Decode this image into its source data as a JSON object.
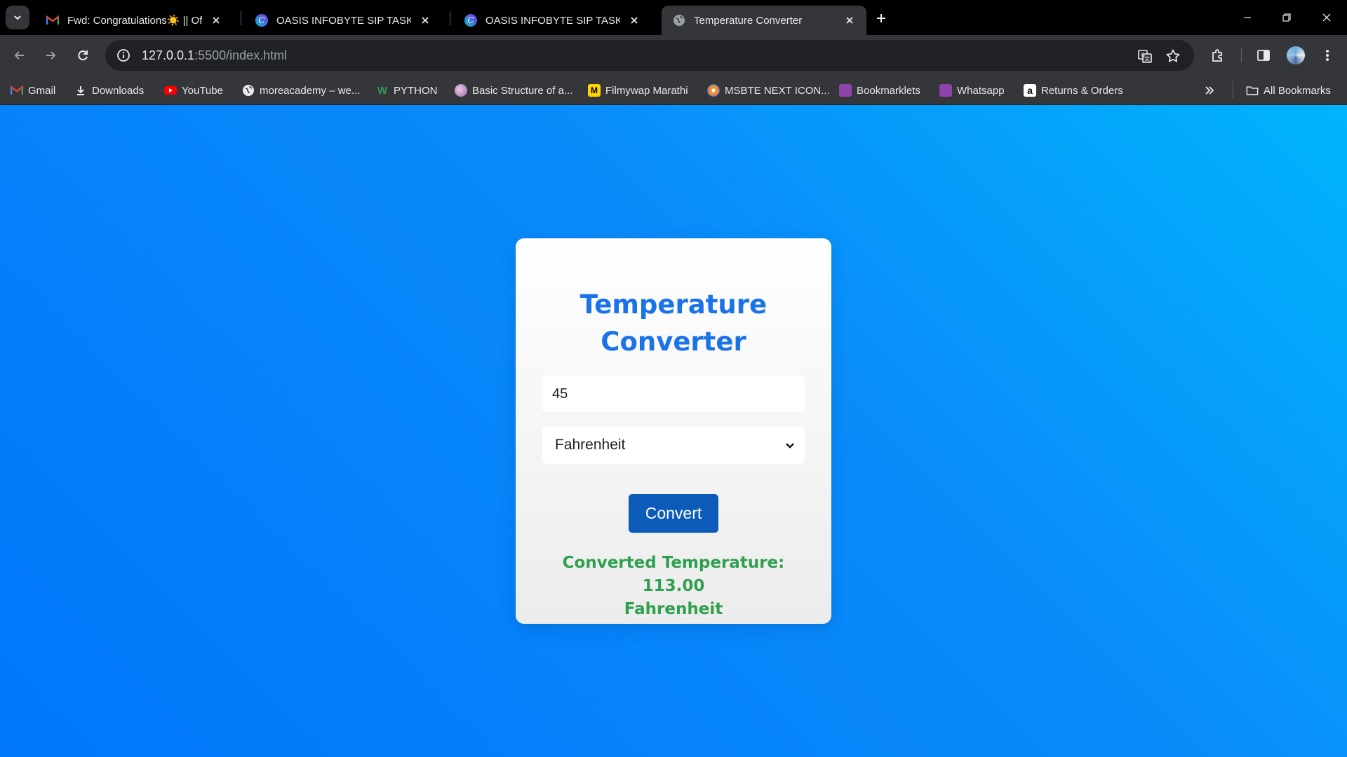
{
  "browser": {
    "tabs": [
      {
        "title": "Fwd: Congratulations☀️ || Offer",
        "icon": "gmail-icon",
        "active": false
      },
      {
        "title": "OASIS INFOBYTE SIP TASK LIST",
        "icon": "canva-icon",
        "active": false
      },
      {
        "title": "OASIS INFOBYTE SIP TASK LIST",
        "icon": "canva-icon",
        "active": false
      },
      {
        "title": "Temperature Converter",
        "icon": "globe-icon",
        "active": true
      }
    ],
    "url_host": "127.0.0.1",
    "url_path": ":5500/index.html",
    "bookmarks": [
      {
        "label": "Gmail",
        "icon": "gmail-icon"
      },
      {
        "label": "Downloads",
        "icon": "download-icon"
      },
      {
        "label": "YouTube",
        "icon": "youtube-icon"
      },
      {
        "label": "moreacademy – we...",
        "icon": "globe-icon"
      },
      {
        "label": "PYTHON",
        "icon": "w-icon"
      },
      {
        "label": "Basic Structure of a...",
        "icon": "avatar-icon"
      },
      {
        "label": "Filmywap Marathi",
        "icon": "m-icon"
      },
      {
        "label": "MSBTE NEXT ICON...",
        "icon": "msbte-icon"
      },
      {
        "label": "Bookmarklets",
        "icon": "bookmarklet-icon"
      },
      {
        "label": "Whatsapp",
        "icon": "bookmarklet-icon"
      },
      {
        "label": "Returns & Orders",
        "icon": "amazon-icon"
      }
    ],
    "all_bookmarks": "All Bookmarks"
  },
  "page": {
    "title": "Temperature Converter",
    "input_value": "45",
    "selected_unit": "Fahrenheit",
    "convert_label": "Convert",
    "result_line1": "Converted Temperature: 113.00",
    "result_line2": "Fahrenheit"
  },
  "colors": {
    "accent_title": "#1a73e8",
    "button": "#0c5bb8",
    "result_text": "#2ea04e",
    "background_start": "#00b4fb",
    "background_end": "#0077fb"
  }
}
